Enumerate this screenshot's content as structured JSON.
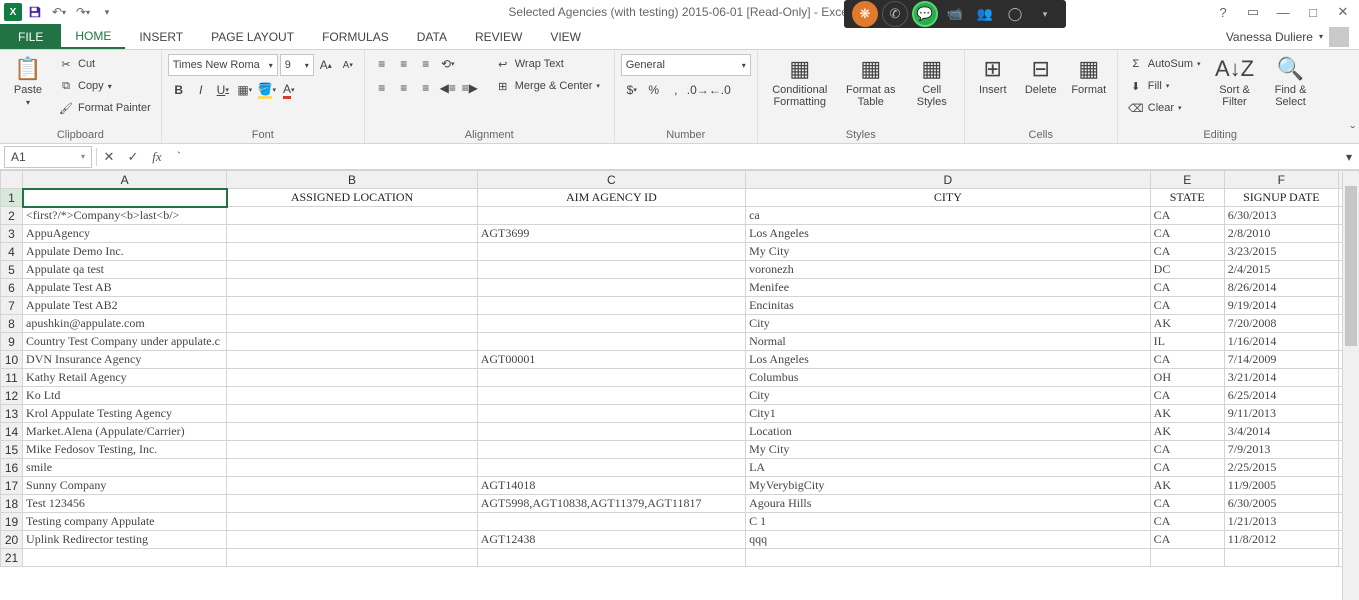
{
  "title": "Selected Agencies (with testing) 2015-06-01  [Read-Only] - Excel",
  "user": "Vanessa Duliere",
  "tabs": {
    "file": "FILE",
    "home": "HOME",
    "insert": "INSERT",
    "page_layout": "PAGE LAYOUT",
    "formulas": "FORMULAS",
    "data": "DATA",
    "review": "REVIEW",
    "view": "VIEW"
  },
  "ribbon": {
    "paste": "Paste",
    "cut": "Cut",
    "copy": "Copy",
    "format_painter": "Format Painter",
    "clipboard": "Clipboard",
    "font_name": "Times New Roma",
    "font_size": "9",
    "font": "Font",
    "wrap": "Wrap Text",
    "merge": "Merge & Center",
    "alignment": "Alignment",
    "number_format": "General",
    "number": "Number",
    "cond": "Conditional Formatting",
    "tbl": "Format as Table",
    "cellst": "Cell Styles",
    "styles": "Styles",
    "insert": "Insert",
    "delete": "Delete",
    "format": "Format",
    "cells": "Cells",
    "autosum": "AutoSum",
    "fill": "Fill",
    "clear": "Clear",
    "sort": "Sort & Filter",
    "find": "Find & Select",
    "editing": "Editing"
  },
  "name_box": "A1",
  "formula_value": "`",
  "columns": [
    "A",
    "B",
    "C",
    "D",
    "E",
    "F"
  ],
  "header_row": [
    "",
    "ASSIGNED LOCATION",
    "AIM AGENCY ID",
    "CITY",
    "STATE",
    "SIGNUP DATE"
  ],
  "rows": [
    {
      "n": 2,
      "a": "<first?/*>Company<b>last<b/>",
      "b": "",
      "c": "",
      "d": "ca",
      "e": "CA",
      "f": "6/30/2013"
    },
    {
      "n": 3,
      "a": "AppuAgency",
      "b": "",
      "c": "AGT3699",
      "d": "Los Angeles",
      "e": "CA",
      "f": "2/8/2010"
    },
    {
      "n": 4,
      "a": "Appulate Demo Inc.",
      "b": "",
      "c": "",
      "d": "My City",
      "e": "CA",
      "f": "3/23/2015"
    },
    {
      "n": 5,
      "a": "Appulate qa test",
      "b": "",
      "c": "",
      "d": "voronezh",
      "e": "DC",
      "f": "2/4/2015"
    },
    {
      "n": 6,
      "a": "Appulate Test AB",
      "b": "",
      "c": "",
      "d": "Menifee",
      "e": "CA",
      "f": "8/26/2014"
    },
    {
      "n": 7,
      "a": "Appulate Test AB2",
      "b": "",
      "c": "",
      "d": "Encinitas",
      "e": "CA",
      "f": "9/19/2014"
    },
    {
      "n": 8,
      "a": "apushkin@appulate.com",
      "b": "",
      "c": "",
      "d": "City",
      "e": "AK",
      "f": "7/20/2008"
    },
    {
      "n": 9,
      "a": "Country Test Company under appulate.c",
      "b": "",
      "c": "",
      "d": "Normal",
      "e": "IL",
      "f": "1/16/2014"
    },
    {
      "n": 10,
      "a": "DVN Insurance Agency",
      "b": "",
      "c": "AGT00001",
      "d": "Los Angeles",
      "e": "CA",
      "f": "7/14/2009"
    },
    {
      "n": 11,
      "a": "Kathy Retail Agency",
      "b": "",
      "c": "",
      "d": "Columbus",
      "e": "OH",
      "f": "3/21/2014"
    },
    {
      "n": 12,
      "a": "Ko Ltd",
      "b": "",
      "c": "",
      "d": "City",
      "e": "CA",
      "f": "6/25/2014"
    },
    {
      "n": 13,
      "a": "Krol Appulate Testing Agency",
      "b": "",
      "c": "",
      "d": "City1",
      "e": "AK",
      "f": "9/11/2013"
    },
    {
      "n": 14,
      "a": "Market.Alena (Appulate/Carrier)",
      "b": "",
      "c": "",
      "d": "Location",
      "e": "AK",
      "f": "3/4/2014"
    },
    {
      "n": 15,
      "a": "Mike Fedosov Testing, Inc.",
      "b": "",
      "c": "",
      "d": "My City",
      "e": "CA",
      "f": "7/9/2013"
    },
    {
      "n": 16,
      "a": "smile",
      "b": "",
      "c": "",
      "d": "LA",
      "e": "CA",
      "f": "2/25/2015"
    },
    {
      "n": 17,
      "a": "Sunny Company",
      "b": "",
      "c": "AGT14018",
      "d": "MyVerybigCity",
      "e": "AK",
      "f": "11/9/2005"
    },
    {
      "n": 18,
      "a": "Test 123456",
      "b": "",
      "c": "AGT5998,AGT10838,AGT11379,AGT11817",
      "d": "Agoura Hills",
      "e": "CA",
      "f": "6/30/2005"
    },
    {
      "n": 19,
      "a": "Testing company Appulate",
      "b": "",
      "c": "",
      "d": "C 1",
      "e": "CA",
      "f": "1/21/2013"
    },
    {
      "n": 20,
      "a": "Uplink Redirector testing",
      "b": "",
      "c": "AGT12438",
      "d": "qqq",
      "e": "CA",
      "f": "11/8/2012"
    }
  ]
}
